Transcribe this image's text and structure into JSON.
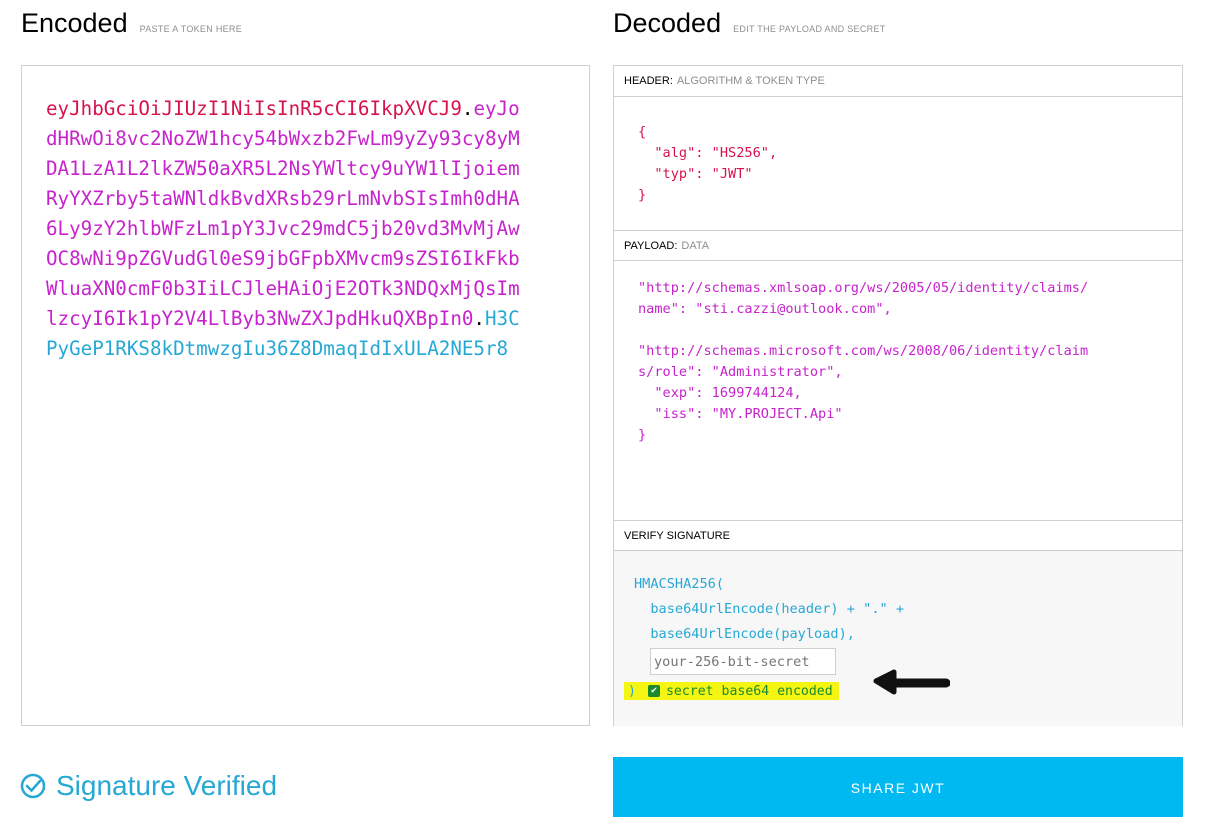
{
  "encoded": {
    "title": "Encoded",
    "hint": "PASTE A TOKEN HERE",
    "token": {
      "header": "eyJhbGciOiJIUzI1NiIsInR5cCI6IkpXVCJ9",
      "payload": "eyJodHRwOi8vc2NoZW1hcy54bWxzb2FwLm9yZy93cy8yMDA1LzA1L2lkZW50aXR5L2NsYWltcy9uYW1lIjoiemRyYXZrby5taWNldkBvdXRsb29rLmNvbSIsImh0dHA6Ly9zY2hlbWFzLm1pY3Jvc29mdC5jb20vd3MvMjAwOC8wNi9pZGVudGl0eS9jbGFpbXMvcm9sZSI6IkFkbWluaXN0cmF0b3IiLCJleHAiOjE2OTk3NDQxMjQsImlzcyI6Ik1pY2V4LlByb3NwZXJpdHkuQXBpIn0",
      "signature": "H3CPyGeP1RKS8kDtmwzgIu36Z8DmaqIdIxULA2NE5r8",
      "dot": "."
    }
  },
  "decoded": {
    "title": "Decoded",
    "hint": "EDIT THE PAYLOAD AND SECRET",
    "header_section": {
      "label": "HEADER:",
      "sub": "ALGORITHM & TOKEN TYPE"
    },
    "header_json": "{\n  \"alg\": \"HS256\",\n  \"typ\": \"JWT\"\n}",
    "payload_section": {
      "label": "PAYLOAD:",
      "sub": "DATA"
    },
    "payload_json": "\"http://schemas.xmlsoap.org/ws/2005/05/identity/claims/\nname\": \"sti.cazzi@outlook.com\",\n\n\"http://schemas.microsoft.com/ws/2008/06/identity/claim\ns/role\": \"Administrator\",\n  \"exp\": 1699744124,\n  \"iss\": \"MY.PROJECT.Api\"\n}",
    "verify_section": {
      "label": "VERIFY SIGNATURE"
    },
    "verify": {
      "line1": "HMACSHA256(",
      "line2": "  base64UrlEncode(header) + \".\" +",
      "line3": "  base64UrlEncode(payload),",
      "secret_placeholder": "your-256-bit-secret",
      "close_paren": ")",
      "secret_base64_label": "secret base64 encoded",
      "secret_base64_checked": true
    }
  },
  "status": {
    "verified_label": "Signature Verified"
  },
  "share_button": {
    "label": "SHARE JWT"
  },
  "colors": {
    "header": "#d6134a",
    "payload": "#c723cc",
    "signature": "#27a8d4",
    "share": "#00b9f1",
    "highlight": "#f5f513"
  }
}
